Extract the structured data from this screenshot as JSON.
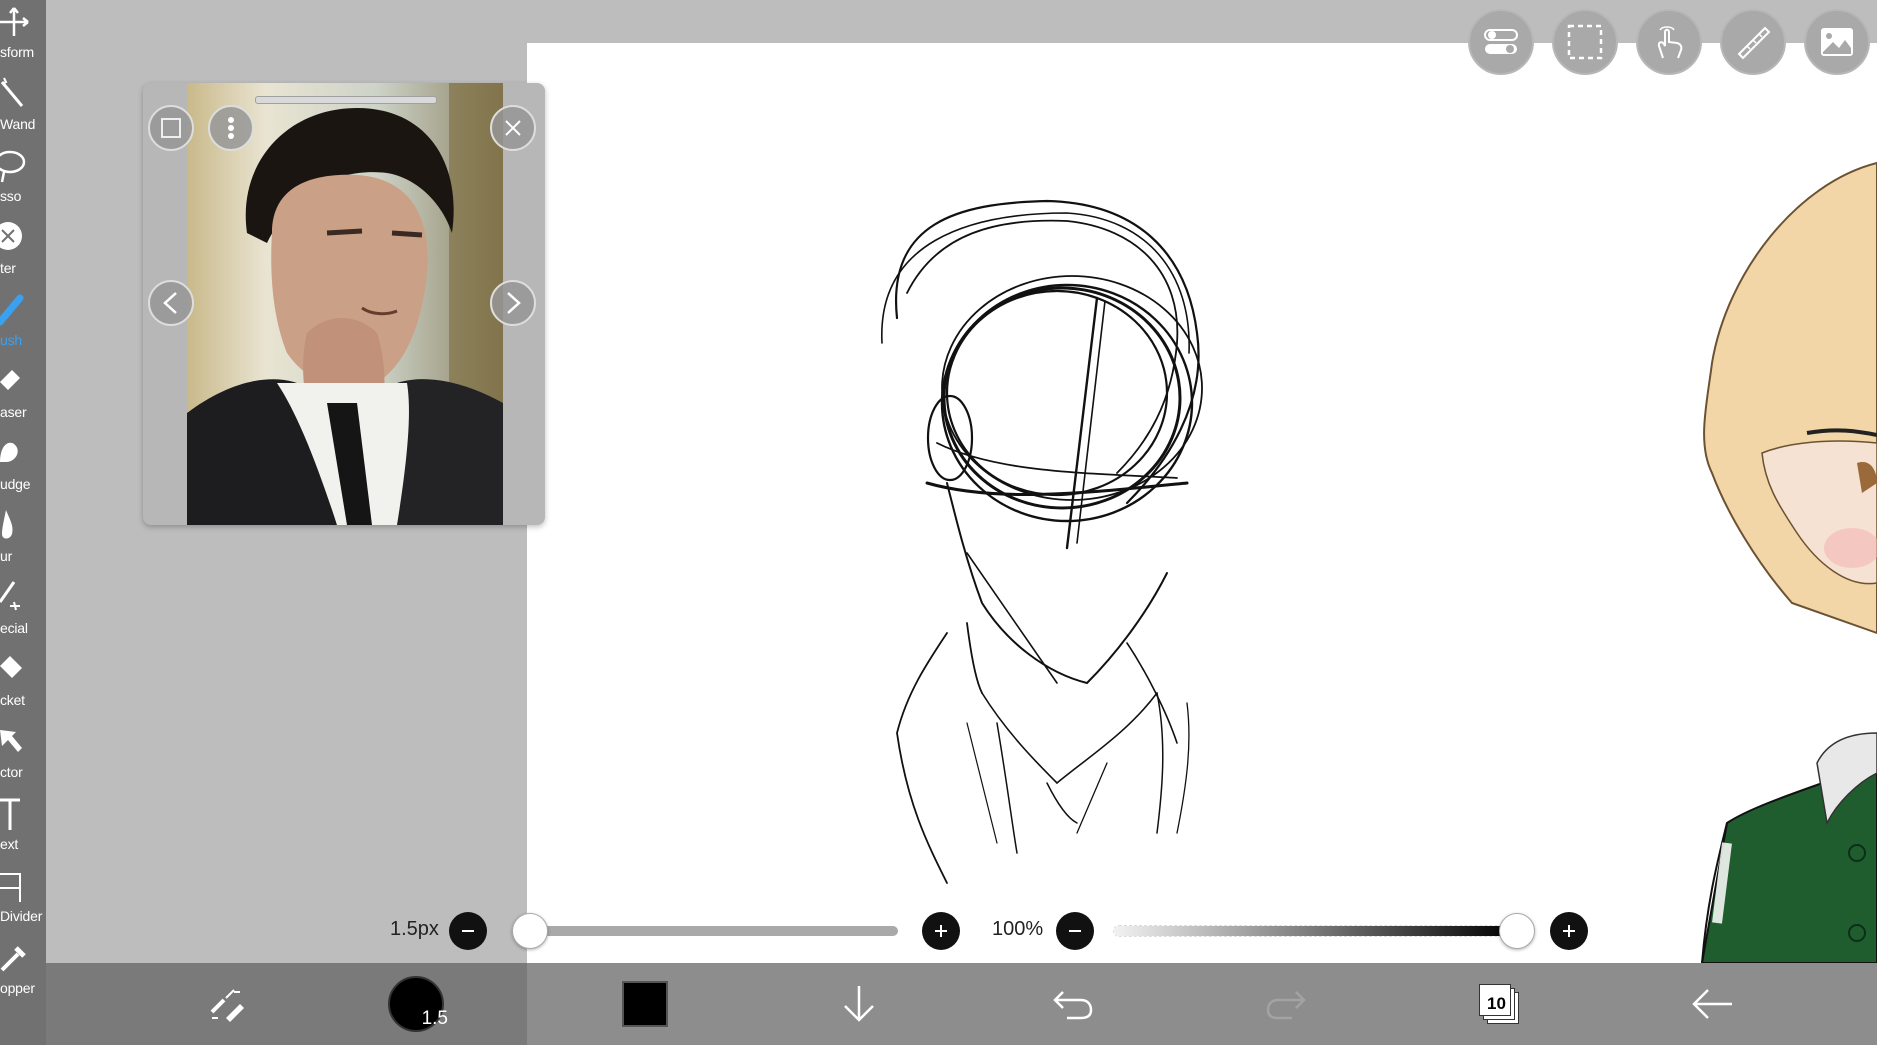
{
  "tools": [
    {
      "label": "sform",
      "icon": "transform-icon"
    },
    {
      "label": " Wand",
      "icon": "magic-wand-icon"
    },
    {
      "label": "sso",
      "icon": "lasso-icon"
    },
    {
      "label": "ter",
      "icon": "filter-icon"
    },
    {
      "label": "ush",
      "icon": "brush-icon",
      "active": true
    },
    {
      "label": "aser",
      "icon": "eraser-icon"
    },
    {
      "label": "udge",
      "icon": "smudge-icon"
    },
    {
      "label": "ur",
      "icon": "blur-icon"
    },
    {
      "label": "ecial",
      "icon": "special-icon"
    },
    {
      "label": "cket",
      "icon": "bucket-icon"
    },
    {
      "label": "ctor",
      "icon": "selector-icon"
    },
    {
      "label": "ext",
      "icon": "text-icon"
    },
    {
      "label": " Divider",
      "icon": "frame-divider-icon"
    },
    {
      "label": "opper",
      "icon": "eyedropper-icon"
    }
  ],
  "top_buttons": [
    "toggle-icon",
    "selection-icon",
    "touch-icon",
    "ruler-icon",
    "material-icon"
  ],
  "brush_size": {
    "value_label": "1.5px",
    "fraction": 0.0
  },
  "opacity": {
    "value_label": "100%",
    "fraction": 1.0
  },
  "bottom_bar": {
    "brush_size_badge": "1.5",
    "color": "#000000",
    "layers_count": "10",
    "icons": [
      "brush-settings-icon",
      "brush-size-icon",
      "color-swatch",
      "download-icon",
      "undo-icon",
      "redo-icon",
      "layers-icon",
      "back-icon"
    ]
  },
  "colors": {
    "accent": "#3aa0f0",
    "toolbar": "#717171",
    "bottom_bar": "#8d8d8d",
    "jacket": "#1f5c2e",
    "hair": "#f2d6a8"
  }
}
